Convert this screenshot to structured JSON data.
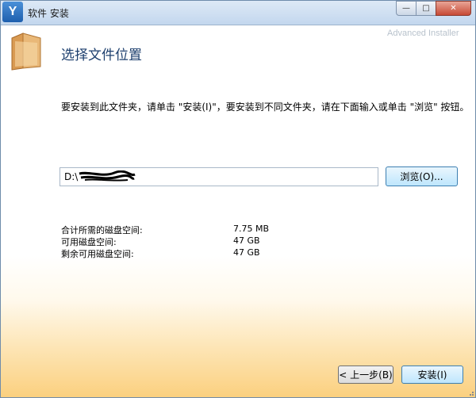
{
  "window": {
    "title": "软件 安装",
    "app_icon_glyph": "Y",
    "minimize_glyph": "—",
    "maximize_glyph": "□",
    "close_glyph": "✕",
    "brand": "Advanced Installer"
  },
  "header": {
    "title": "选择文件位置"
  },
  "main": {
    "instruction": "要安装到此文件夹，请单击 \"安装(I)\"，要安装到不同文件夹，请在下面输入或单击 \"浏览\" 按钮。",
    "path_value": "D:\\",
    "browse_label": "浏览(O)...",
    "space": [
      {
        "label": "合计所需的磁盘空间:",
        "value": "7.75 MB"
      },
      {
        "label": "可用磁盘空间:",
        "value": "47 GB"
      },
      {
        "label": "剩余可用磁盘空间:",
        "value": "47 GB"
      }
    ]
  },
  "footer": {
    "back_label": "< 上一步(B)",
    "install_label": "安装(I)"
  },
  "colors": {
    "title_text": "#1d3f6e",
    "accent_button": "#bee6fd",
    "bottom_gradient": "#fbd07f"
  }
}
